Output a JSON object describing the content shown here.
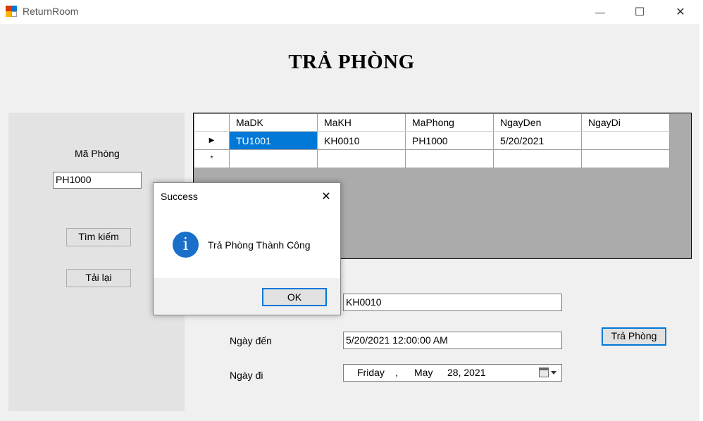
{
  "window": {
    "title": "ReturnRoom",
    "minimize_glyph": "—",
    "maximize_glyph": "☐",
    "close_glyph": "✕",
    "app_icon": "form-app-icon"
  },
  "heading": "TRẢ PHÒNG",
  "left_panel": {
    "room_label": "Mã Phòng",
    "room_value": "PH1000",
    "search_button": "Tìm kiếm",
    "reload_button": "Tải lại"
  },
  "grid": {
    "columns": [
      "MaDK",
      "MaKH",
      "MaPhong",
      "NgayDen",
      "NgayDi"
    ],
    "rows": [
      {
        "indicator": "▶",
        "cells": [
          "TU1001",
          "KH0010",
          "PH1000",
          "5/20/2021",
          ""
        ]
      },
      {
        "indicator": "*",
        "cells": [
          "",
          "",
          "",
          "",
          ""
        ]
      }
    ],
    "selected_cell": "TU1001"
  },
  "form": {
    "customer_value": "KH0010",
    "arrival_label": "Ngày đến",
    "arrival_value": "5/20/2021 12:00:00 AM",
    "departure_label": "Ngày đi",
    "departure_date": {
      "weekday": "Friday",
      "sep": ",",
      "month": "May",
      "day_year": "28, 2021"
    },
    "return_button": "Trả Phòng"
  },
  "dialog": {
    "title": "Success",
    "message": "Trả Phòng Thành Công",
    "ok_button": "OK",
    "icon": "info-icon",
    "close_glyph": "✕"
  },
  "colors": {
    "accent": "#0078d7",
    "info_icon": "#1a6fc9",
    "grid_background": "#ababab",
    "panel": "#e3e3e3"
  }
}
